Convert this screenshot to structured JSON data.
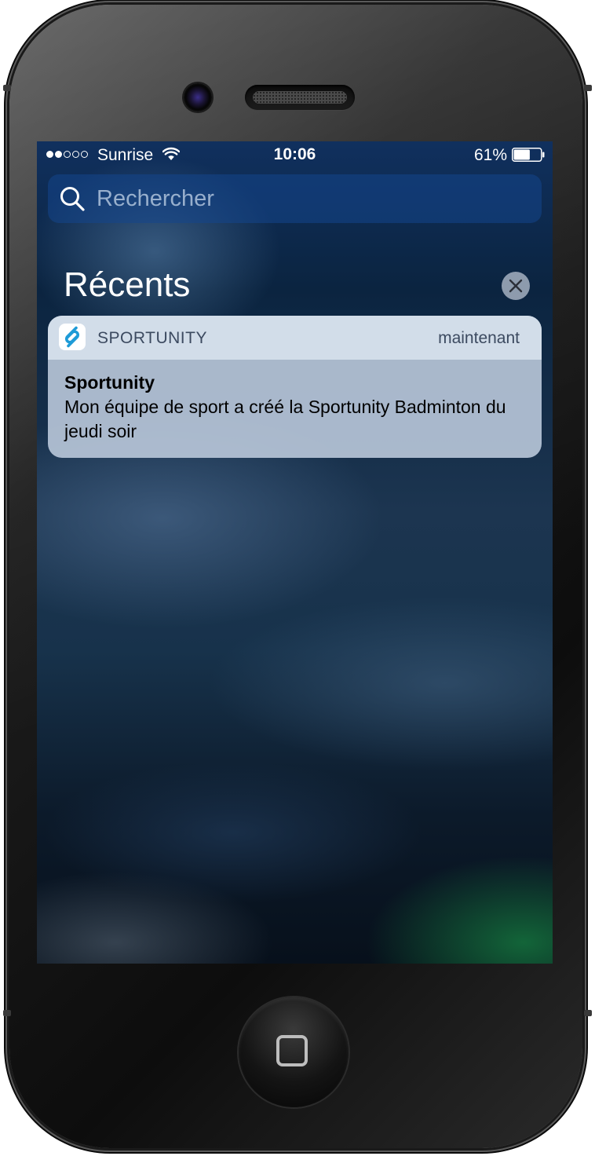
{
  "status_bar": {
    "carrier": "Sunrise",
    "time": "10:06",
    "battery_percent": "61%",
    "battery_level": 0.61,
    "signal_bars_filled": 2,
    "signal_bars_total": 5
  },
  "search": {
    "placeholder": "Rechercher"
  },
  "recents": {
    "title": "Récents"
  },
  "notification": {
    "app_name": "SPORTUNITY",
    "time": "maintenant",
    "title": "Sportunity",
    "message": "Mon équipe de sport a créé la Sportunity Badminton du jeudi soir",
    "app_icon": "sportunity-logo-icon",
    "accent_color": "#1e9bd7"
  },
  "icons": {
    "wifi": "wifi-icon",
    "battery": "battery-icon",
    "search": "search-icon",
    "clear": "close-icon",
    "home": "home-button"
  }
}
